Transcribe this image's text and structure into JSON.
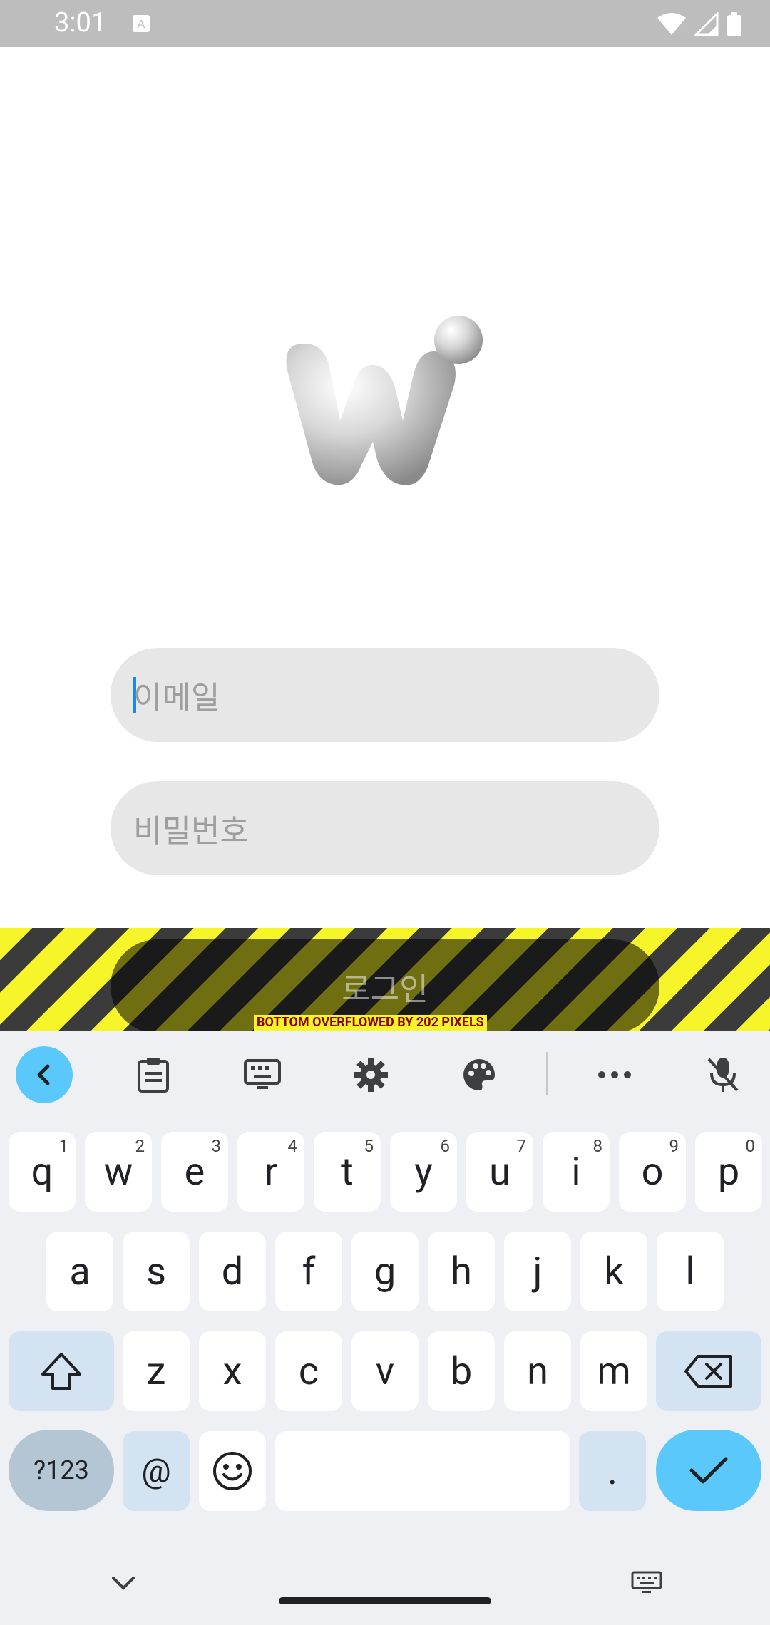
{
  "status_bar": {
    "time": "3:01"
  },
  "form": {
    "email_placeholder": "이메일",
    "password_placeholder": "비밀번호",
    "login_label": "로그인"
  },
  "debug": {
    "overflow_text": "BOTTOM OVERFLOWED BY 202 PIXELS"
  },
  "keyboard": {
    "row1": [
      {
        "k": "q",
        "h": "1"
      },
      {
        "k": "w",
        "h": "2"
      },
      {
        "k": "e",
        "h": "3"
      },
      {
        "k": "r",
        "h": "4"
      },
      {
        "k": "t",
        "h": "5"
      },
      {
        "k": "y",
        "h": "6"
      },
      {
        "k": "u",
        "h": "7"
      },
      {
        "k": "i",
        "h": "8"
      },
      {
        "k": "o",
        "h": "9"
      },
      {
        "k": "p",
        "h": "0"
      }
    ],
    "row2": [
      "a",
      "s",
      "d",
      "f",
      "g",
      "h",
      "j",
      "k",
      "l"
    ],
    "row3": [
      "z",
      "x",
      "c",
      "v",
      "b",
      "n",
      "m"
    ],
    "sym_label": "?123",
    "at_label": "@",
    "period_label": "."
  },
  "colors": {
    "accent": "#5ac8fa",
    "field_bg": "#e7e7e7",
    "stripe_yellow": "#f5f529"
  }
}
